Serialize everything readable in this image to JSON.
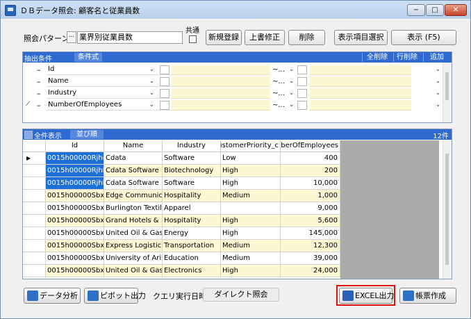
{
  "window": {
    "title": "ＤＢデータ照会: 顧客名と従業員数",
    "controls": {
      "min": "−",
      "max": "□",
      "close": "✕"
    }
  },
  "toolbar": {
    "pattern_label": "照会パターン",
    "pattern_button": "...",
    "pattern_value": "業界別従業員数",
    "shared_label": "共通",
    "new_label": "新規登録",
    "overwrite_label": "上書修正",
    "delete_label": "削除",
    "columns_label": "表示項目選択",
    "display_label": "表示 (F5)"
  },
  "filter": {
    "header_label": "抽出条件",
    "tab_label": "条件式",
    "clear_all_label": "全削除",
    "delete_row_label": "行削除",
    "add_label": "追加",
    "rows": [
      {
        "marker": "",
        "dash": "–",
        "field": "Id",
        "operator": "~..."
      },
      {
        "marker": "",
        "dash": "–",
        "field": "Name",
        "operator": "~..."
      },
      {
        "marker": "",
        "dash": "–",
        "field": "Industry",
        "operator": "~..."
      },
      {
        "marker": "⟋",
        "dash": "–",
        "field": "NumberOfEmployees",
        "operator": "~..."
      }
    ]
  },
  "results": {
    "show_all_label": "全件表示",
    "sort_tab_label": "並び順",
    "count_label": "12件",
    "columns": [
      "Id",
      "Name",
      "Industry",
      "CustomerPriority_c",
      "NumberOfEmployees"
    ],
    "rows": [
      {
        "id": "0015h00000Rjh4...",
        "name": "Cdata",
        "industry": "Software",
        "priority": "Low",
        "employees": "400",
        "highlight": false
      },
      {
        "id": "0015h00000RjhKf...",
        "name": "Cdata Software",
        "industry": "Biotechnology",
        "priority": "High",
        "employees": "200",
        "highlight": true
      },
      {
        "id": "0015h00000RjhK...",
        "name": "Cdata Software ...",
        "industry": "Software",
        "priority": "High",
        "employees": "10,000",
        "highlight": false
      },
      {
        "id": "0015h00000Sbxf...",
        "name": "Edge Communica...",
        "industry": "Hospitality",
        "priority": "Medium",
        "employees": "1,000",
        "highlight": true
      },
      {
        "id": "0015h00000Sbxf...",
        "name": "Burlington Textil...",
        "industry": "Apparel",
        "priority": "",
        "employees": "9,000",
        "highlight": false
      },
      {
        "id": "0015h00000Sbxf...",
        "name": "Grand Hotels & ...",
        "industry": "Hospitality",
        "priority": "High",
        "employees": "5,600",
        "highlight": true
      },
      {
        "id": "0015h00000Sbxf...",
        "name": "United Oil & Gas...",
        "industry": "Energy",
        "priority": "High",
        "employees": "145,000",
        "highlight": false
      },
      {
        "id": "0015h00000Sbxf...",
        "name": "Express Logistic...",
        "industry": "Transportation",
        "priority": "Medium",
        "employees": "12,300",
        "highlight": true
      },
      {
        "id": "0015h00000Sbxf...",
        "name": "University of Ari...",
        "industry": "Education",
        "priority": "Medium",
        "employees": "39,000",
        "highlight": false
      },
      {
        "id": "0015h00000Sbxf...",
        "name": "United Oil & Gas,...",
        "industry": "Electronics",
        "priority": "High",
        "employees": "24,000",
        "highlight": true
      }
    ]
  },
  "footer": {
    "analysis_label": "データ分析",
    "pivot_label": "ピボット出力",
    "query_time_label": "クエリ実行日時",
    "direct_query_label": "ダイレクト照会",
    "excel_label": "EXCEL出力",
    "report_label": "帳票作成"
  },
  "colors": {
    "accent": "#2e6ad0",
    "highlight_row": "#fbf8d3",
    "selection": "#1e6fd6",
    "callout": "#e01010"
  }
}
